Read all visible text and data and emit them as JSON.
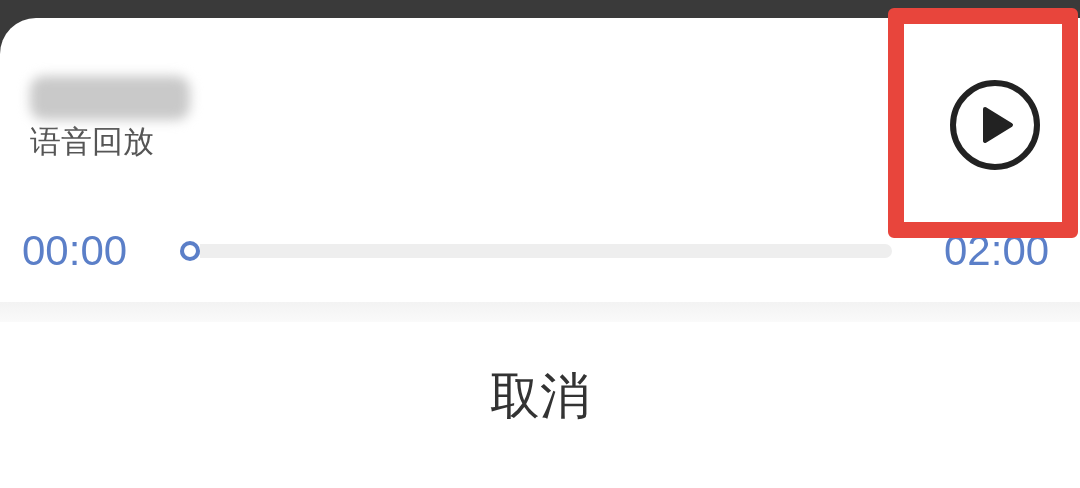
{
  "player": {
    "title": {
      "kind": "blurred"
    },
    "subtitle": "语音回放",
    "play_button": {
      "highlighted": true
    },
    "current_time": "00:00",
    "total_time": "02:00",
    "progress": {
      "level": 0
    }
  },
  "cancel_button": "取消"
}
